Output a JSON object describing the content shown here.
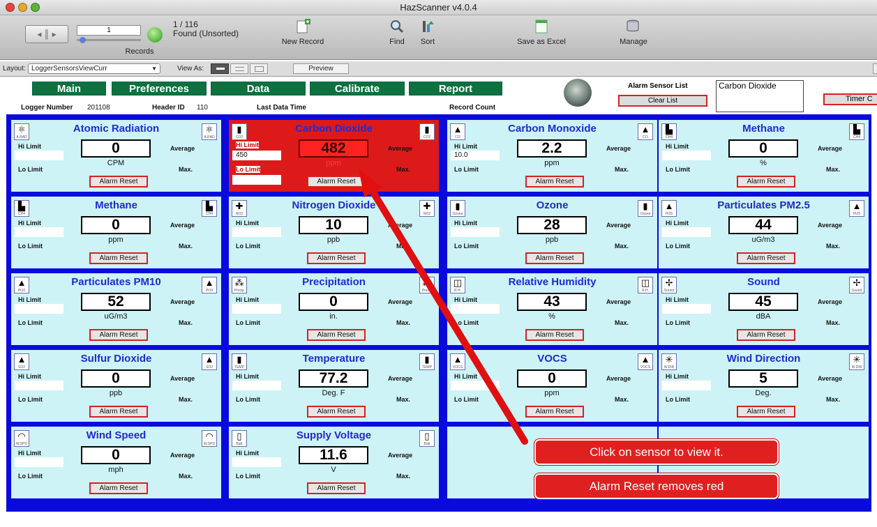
{
  "window": {
    "title": "HazScanner v4.0.4"
  },
  "toolbar": {
    "records_label": "Records",
    "record_number": "1",
    "record_count": "1 / 116",
    "found_status": "Found (Unsorted)",
    "new_record": "New Record",
    "find": "Find",
    "sort": "Sort",
    "save_excel": "Save as Excel",
    "manage": "Manage"
  },
  "layoutbar": {
    "layout_label": "Layout:",
    "layout_value": "LoggerSensorsViewCurr",
    "view_as": "View As:",
    "preview": "Preview"
  },
  "nav": {
    "main": "Main",
    "preferences": "Preferences",
    "data": "Data",
    "calibrate": "Calibrate",
    "report": "Report"
  },
  "header": {
    "logger_number_label": "Logger Number",
    "logger_number": "201108",
    "header_id_label": "Header ID",
    "header_id": "110",
    "last_data_time": "Last Data Time",
    "record_count": "Record Count",
    "alarm_sensor_list": "Alarm Sensor List",
    "alarm_list_value": "Carbon Dioxide",
    "clear_list": "Clear List",
    "timer": "Timer C"
  },
  "labels": {
    "hi": "Hi Limit",
    "lo": "Lo Limit",
    "avg": "Average",
    "max": "Max.",
    "reset": "Alarm Reset"
  },
  "sensors": [
    {
      "name": "Atomic Radiation",
      "value": "0",
      "unit": "CPM",
      "icon": "atom-icon",
      "glyph": "⚛",
      "tag": "A.RAD",
      "hi_val": "",
      "alarm": false
    },
    {
      "name": "Carbon Dioxide",
      "value": "482",
      "unit": "ppm",
      "icon": "co2-cylinder-icon",
      "glyph": "▮",
      "tag": "CO2",
      "hi_val": "450",
      "alarm": true
    },
    {
      "name": "Carbon Monoxide",
      "value": "2.2",
      "unit": "ppm",
      "icon": "fire-icon",
      "glyph": "▲",
      "tag": "CO",
      "hi_val": "10.0",
      "alarm": false
    },
    {
      "name": "Methane",
      "value": "0",
      "unit": "%",
      "icon": "factory-icon",
      "glyph": "▙",
      "tag": "CH4",
      "hi_val": "",
      "alarm": false
    },
    {
      "name": "Methane",
      "value": "0",
      "unit": "ppm",
      "icon": "factory-icon",
      "glyph": "▙",
      "tag": "CH4",
      "hi_val": "",
      "alarm": false
    },
    {
      "name": "Nitrogen Dioxide",
      "value": "10",
      "unit": "ppb",
      "icon": "molecule-icon",
      "glyph": "✚",
      "tag": "NO2",
      "hi_val": "",
      "alarm": false
    },
    {
      "name": "Ozone",
      "value": "28",
      "unit": "ppb",
      "icon": "ozone-cylinder-icon",
      "glyph": "▮",
      "tag": "Ozone",
      "hi_val": "",
      "alarm": false
    },
    {
      "name": "Particulates PM2.5",
      "value": "44",
      "unit": "uG/m3",
      "icon": "smokestack-icon",
      "glyph": "▲",
      "tag": "Pt25",
      "hi_val": "",
      "alarm": false
    },
    {
      "name": "Particulates PM10",
      "value": "52",
      "unit": "uG/m3",
      "icon": "smokestack-icon",
      "glyph": "▲",
      "tag": "Pt10",
      "hi_val": "",
      "alarm": false
    },
    {
      "name": "Precipitation",
      "value": "0",
      "unit": "in.",
      "icon": "rain-icon",
      "glyph": "⁂",
      "tag": "Precip",
      "hi_val": "",
      "alarm": false
    },
    {
      "name": "Relative Humidity",
      "value": "43",
      "unit": "%",
      "icon": "humidity-icon",
      "glyph": "◫",
      "tag": "R.H.",
      "hi_val": "",
      "alarm": false
    },
    {
      "name": "Sound",
      "value": "45",
      "unit": "dBA",
      "icon": "sound-icon",
      "glyph": "✢",
      "tag": "Sound",
      "hi_val": "",
      "alarm": false
    },
    {
      "name": "Sulfur Dioxide",
      "value": "0",
      "unit": "ppb",
      "icon": "smokestack-icon",
      "glyph": "▲",
      "tag": "SO2",
      "hi_val": "",
      "alarm": false
    },
    {
      "name": "Temperature",
      "value": "77.2",
      "unit": "Deg. F",
      "icon": "thermometer-icon",
      "glyph": "▮",
      "tag": "TEMP",
      "hi_val": "",
      "alarm": false
    },
    {
      "name": "VOCS",
      "value": "0",
      "unit": "ppm",
      "icon": "smokestack-icon",
      "glyph": "▲",
      "tag": "VOCS",
      "hi_val": "",
      "alarm": false
    },
    {
      "name": "Wind Direction",
      "value": "5",
      "unit": "Deg.",
      "icon": "compass-icon",
      "glyph": "✳",
      "tag": "W.DIR",
      "hi_val": "",
      "alarm": false
    },
    {
      "name": "Wind Speed",
      "value": "0",
      "unit": "mph",
      "icon": "anemometer-icon",
      "glyph": "◠",
      "tag": "W.SPD",
      "hi_val": "",
      "alarm": false
    },
    {
      "name": "Supply Voltage",
      "value": "11.6",
      "unit": "V",
      "icon": "battery-icon",
      "glyph": "▯",
      "tag": "Batt",
      "hi_val": "",
      "alarm": false
    }
  ],
  "annotations": {
    "click_sensor": "Click on sensor to view it.",
    "alarm_reset_note": "Alarm Reset removes  red"
  }
}
